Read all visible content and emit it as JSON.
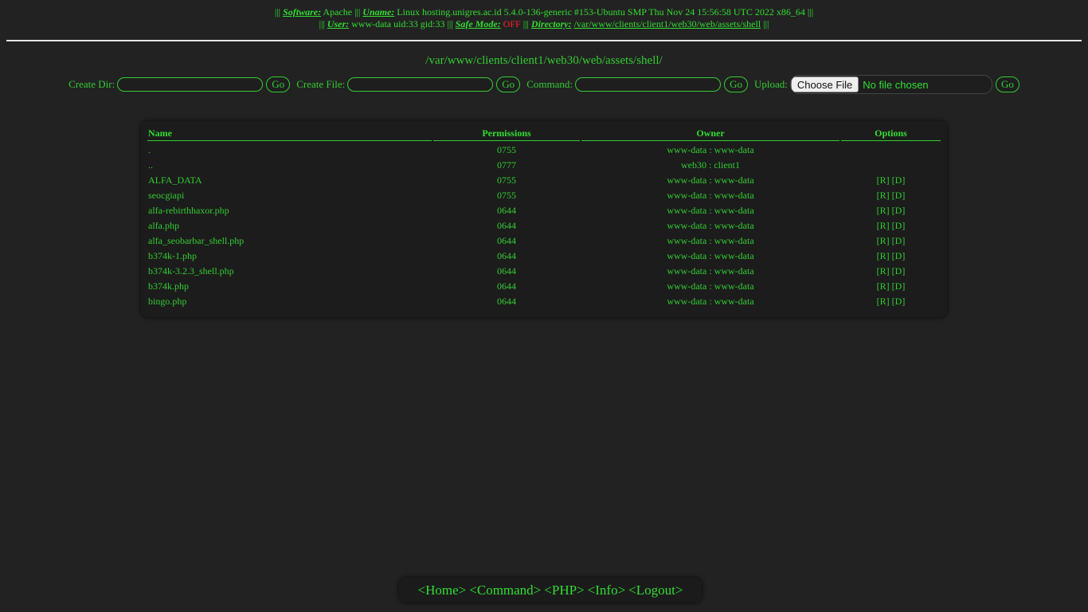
{
  "info": {
    "sep": "|||",
    "software_label": "Software:",
    "software_value": "Apache",
    "uname_label": "Uname:",
    "uname_value": "Linux hosting.unigres.ac.id 5.4.0-136-generic #153-Ubuntu SMP Thu Nov 24 15:56:58 UTC 2022 x86_64",
    "user_label": "User:",
    "user_value": "www-data uid:33 gid:33",
    "safemode_label": "Safe Mode:",
    "safemode_value": "OFF",
    "directory_label": "Directory:",
    "directory_value": "/var/www/clients/client1/web30/web/assets/shell"
  },
  "current_path": "/var/www/clients/client1/web30/web/assets/shell/",
  "forms": {
    "create_dir_label": "Create Dir:",
    "create_dir_value": "",
    "create_file_label": "Create File:",
    "create_file_value": "",
    "command_label": "Command:",
    "command_value": "",
    "upload_label": "Upload:",
    "choose_file_label": "Choose File",
    "no_file_text": "No file chosen",
    "go_label": "Go"
  },
  "table": {
    "headers": {
      "name": "Name",
      "permissions": "Permissions",
      "owner": "Owner",
      "options": "Options"
    },
    "rows": [
      {
        "name": ".",
        "perm": "0755",
        "owner": "www-data : www-data",
        "options": ""
      },
      {
        "name": "..",
        "perm": "0777",
        "owner": "web30 : client1",
        "options": ""
      },
      {
        "name": "ALFA_DATA",
        "perm": "0755",
        "owner": "www-data : www-data",
        "options": "[R] [D]"
      },
      {
        "name": "seocgiapi",
        "perm": "0755",
        "owner": "www-data : www-data",
        "options": "[R] [D]"
      },
      {
        "name": "alfa-rebirthhaxor.php",
        "perm": "0644",
        "owner": "www-data : www-data",
        "options": "[R] [D]"
      },
      {
        "name": "alfa.php",
        "perm": "0644",
        "owner": "www-data : www-data",
        "options": "[R] [D]"
      },
      {
        "name": "alfa_seobarbar_shell.php",
        "perm": "0644",
        "owner": "www-data : www-data",
        "options": "[R] [D]"
      },
      {
        "name": "b374k-1.php",
        "perm": "0644",
        "owner": "www-data : www-data",
        "options": "[R] [D]"
      },
      {
        "name": "b374k-3.2.3_shell.php",
        "perm": "0644",
        "owner": "www-data : www-data",
        "options": "[R] [D]"
      },
      {
        "name": "b374k.php",
        "perm": "0644",
        "owner": "www-data : www-data",
        "options": "[R] [D]"
      },
      {
        "name": "bingo.php",
        "perm": "0644",
        "owner": "www-data : www-data",
        "options": "[R] [D]"
      }
    ]
  },
  "nav": {
    "home": "<Home>",
    "command": "<Command>",
    "php": "<PHP>",
    "info": "<Info>",
    "logout": "<Logout>"
  },
  "colors": {
    "background": "#222222",
    "text_green": "#33cc33",
    "safe_mode_off": "#ff2222",
    "separator": "#e6e6e6"
  }
}
